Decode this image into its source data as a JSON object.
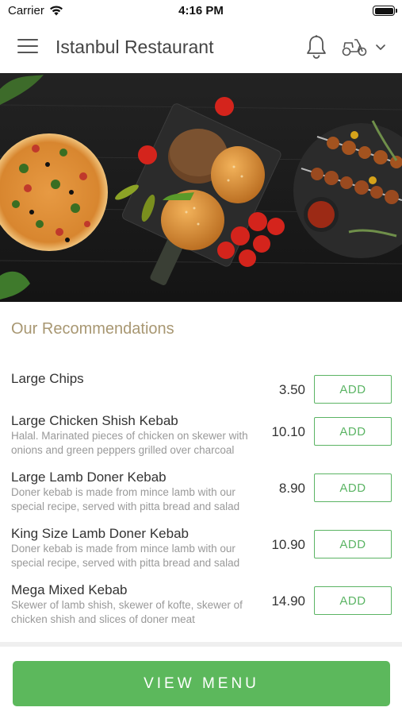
{
  "status_bar": {
    "carrier": "Carrier",
    "time": "4:16 PM"
  },
  "header": {
    "title": "Istanbul Restaurant",
    "icons": [
      "menu-icon",
      "bell-icon",
      "delivery-scooter-icon",
      "chevron-down-icon"
    ]
  },
  "hero": {
    "description": "food-banner"
  },
  "recommendations": {
    "title": "Our Recommendations",
    "add_label": "ADD",
    "items": [
      {
        "name": "Large Chips",
        "description": "",
        "price": "3.50"
      },
      {
        "name": "Large Chicken Shish Kebab",
        "description": "Halal. Marinated pieces of chicken on skewer with onions and green peppers grilled over charcoal",
        "price": "10.10"
      },
      {
        "name": "Large Lamb Doner Kebab",
        "description": "Doner kebab is made from mince lamb with our special recipe, served with pitta bread and salad",
        "price": "8.90"
      },
      {
        "name": "King Size Lamb Doner Kebab",
        "description": "Doner kebab is made from mince lamb with our special recipe, served with pitta bread and salad",
        "price": "10.90"
      },
      {
        "name": "Mega Mixed Kebab",
        "description": "Skewer of lamb shish, skewer of kofte, skewer of chicken shish and slices of doner meat",
        "price": "14.90"
      }
    ]
  },
  "footer": {
    "view_menu_label": "VIEW MENU"
  },
  "colors": {
    "accent_green": "#5cb85c",
    "section_title": "#a89772"
  }
}
